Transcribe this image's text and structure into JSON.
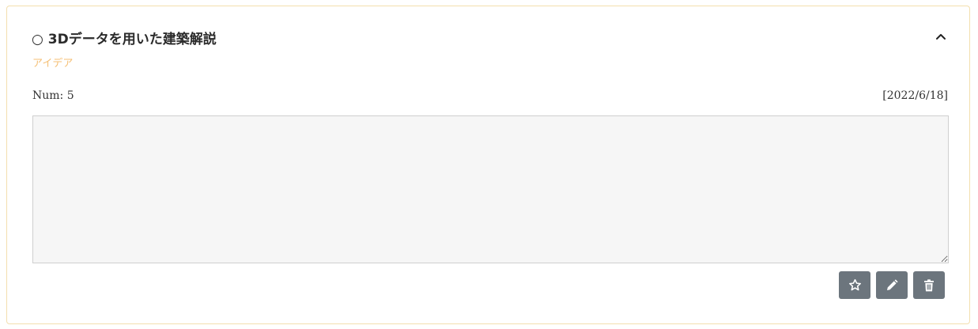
{
  "card": {
    "title": "○ 3Dデータを用いた建築解説",
    "category": "アイデア",
    "num_label": "Num: 5",
    "date": "[2022/6/18]",
    "memo_value": ""
  },
  "icons": {
    "collapse": "chevron-up-icon",
    "favorite": "star-outline-icon",
    "edit": "pencil-icon",
    "delete": "trash-icon"
  },
  "colors": {
    "border": "#f3dfae",
    "category": "#f5bf74",
    "button": "#6c757d",
    "memo_background": "#f6f6f6"
  }
}
